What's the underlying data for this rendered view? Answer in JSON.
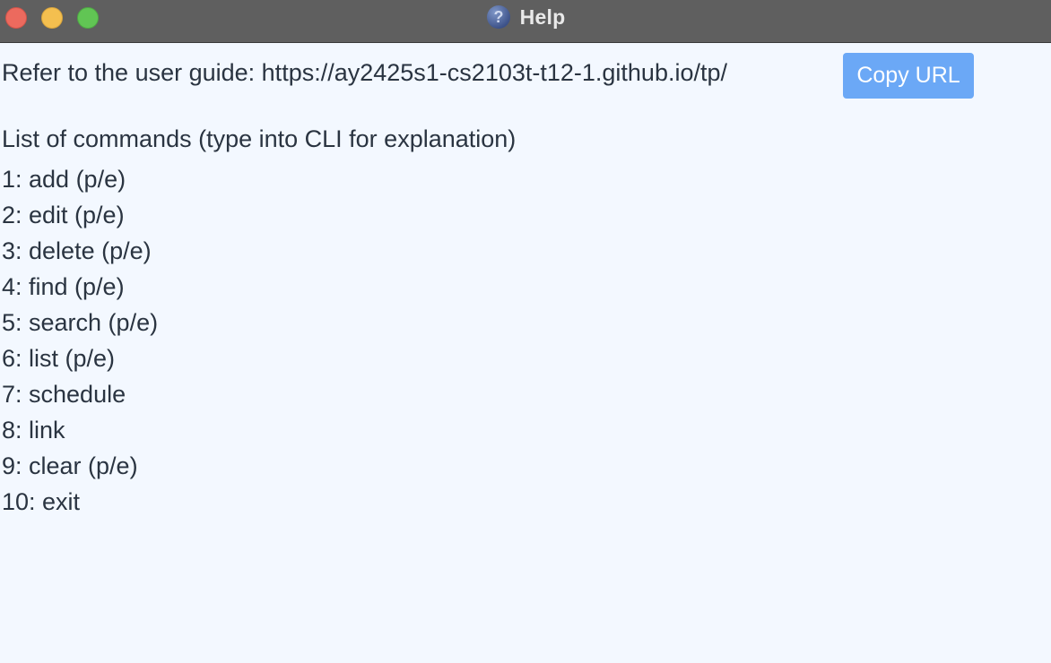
{
  "window": {
    "title": "Help",
    "title_icon": "question-mark-icon",
    "controls": [
      "close",
      "minimize",
      "zoom"
    ],
    "colors": {
      "titlebar": "#5f5f5f",
      "background": "#f3f8ff",
      "text": "#2a3441",
      "button": "#6ba8f6"
    }
  },
  "help": {
    "user_guide_text": "Refer to the user guide: https://ay2425s1-cs2103t-t12-1.github.io/tp/",
    "copy_button_label": "Copy URL",
    "commands_heading": "List of commands (type into CLI for explanation)",
    "commands": [
      "1: add (p/e)",
      "2: edit (p/e)",
      "3: delete (p/e)",
      "4: find (p/e)",
      "5: search (p/e)",
      "6: list (p/e)",
      "7: schedule",
      "8: link",
      "9: clear (p/e)",
      "10: exit"
    ]
  }
}
